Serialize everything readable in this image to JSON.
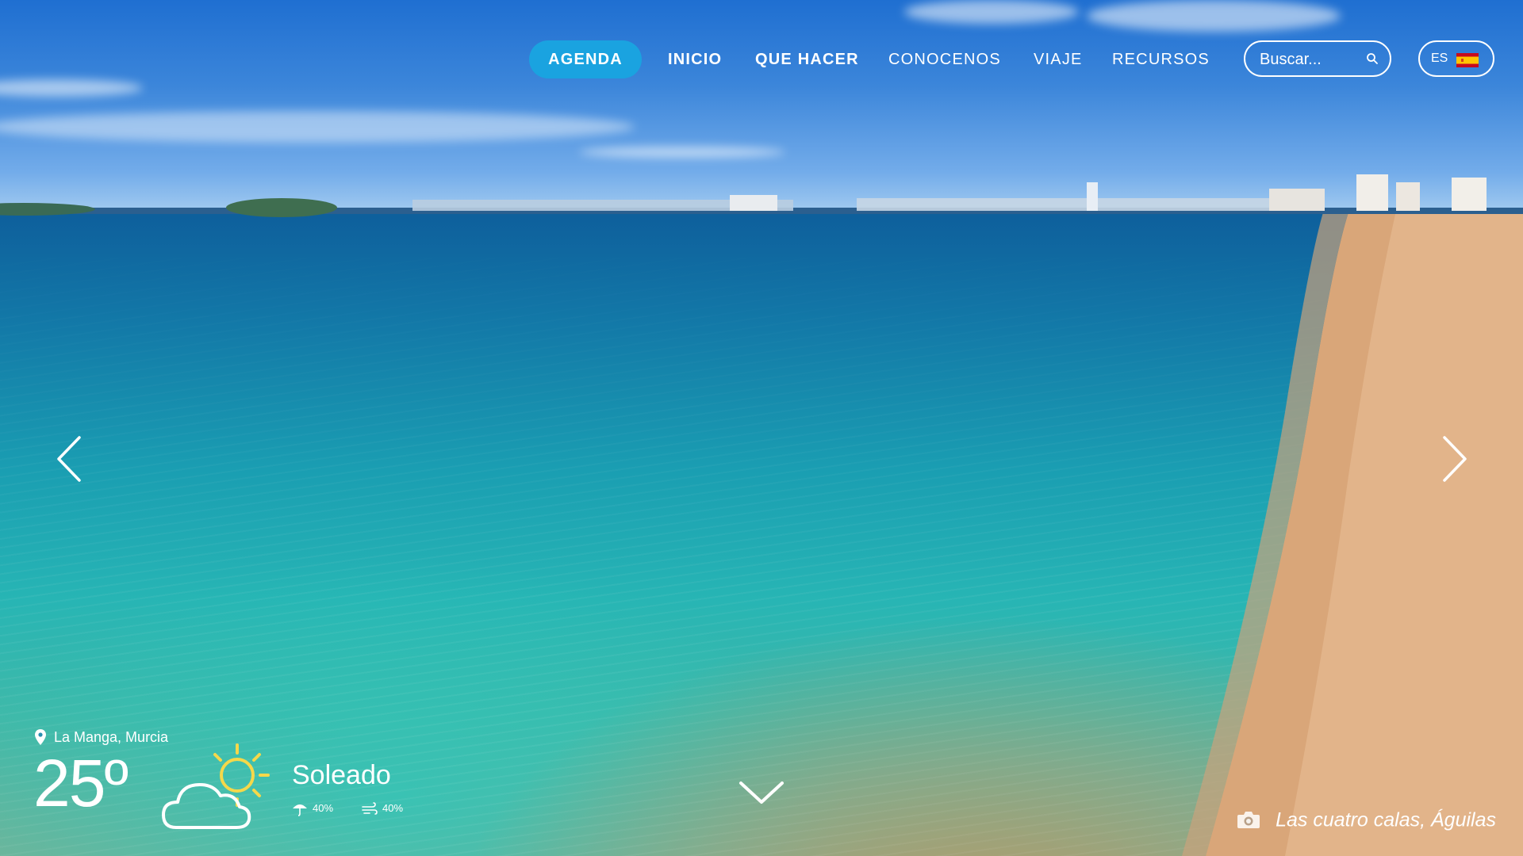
{
  "nav": {
    "items": [
      "AGENDA",
      "INICIO",
      "QUE HACER",
      "CONOCENOS",
      "VIAJE",
      "RECURSOS"
    ],
    "accent_color": "#1aa3e0"
  },
  "search": {
    "placeholder": "Buscar..."
  },
  "language": {
    "code": "ES",
    "flag_icon": "spain-flag-icon"
  },
  "weather": {
    "location": "La Manga, Murcia",
    "temperature": "25º",
    "condition": "Soleado",
    "condition_icon": "partly-sunny-icon",
    "rain_chance": "40%",
    "wind": "40%"
  },
  "caption": {
    "text": "Las cuatro calas, Águilas"
  }
}
